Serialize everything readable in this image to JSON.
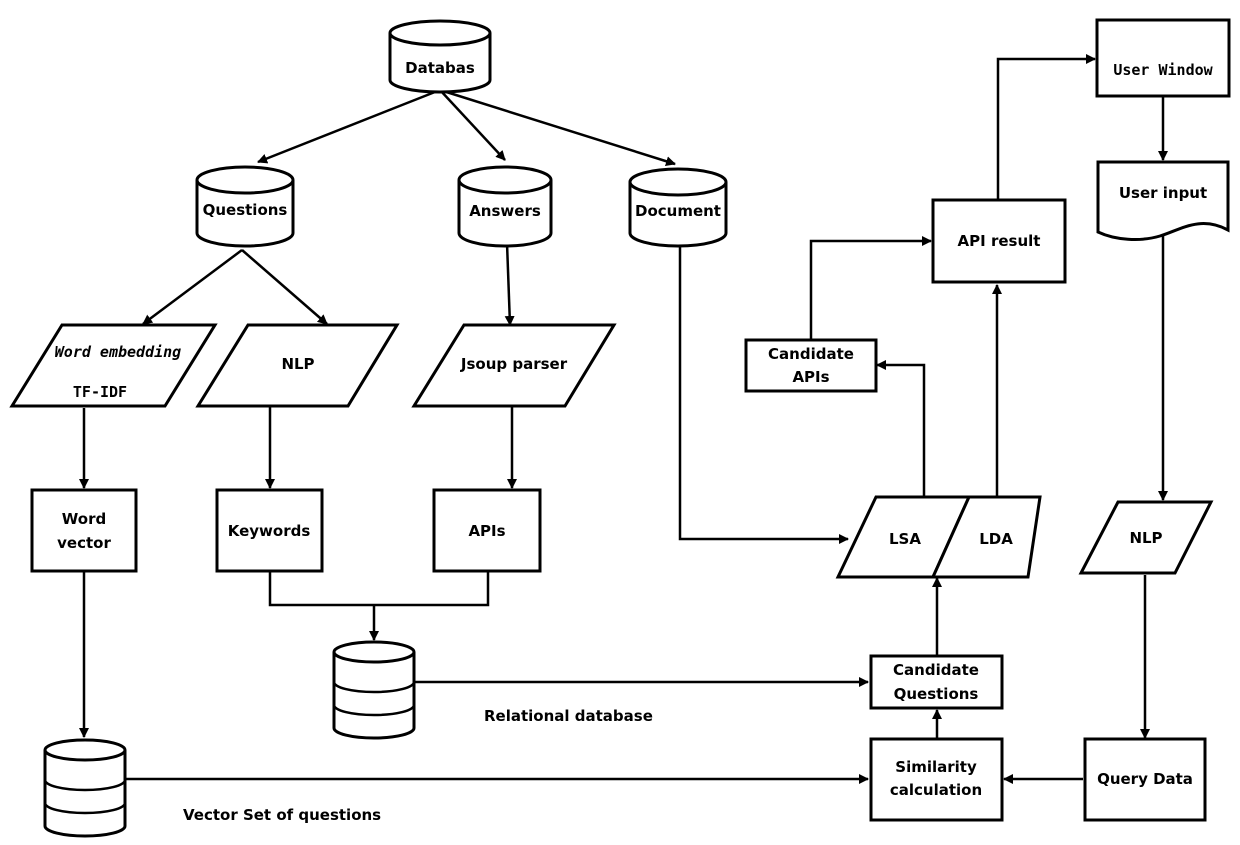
{
  "diagram": {
    "nodes": {
      "database": "Databas",
      "questions": "Questions",
      "answers": "Answers",
      "document": "Document",
      "word_embedding": "Word embedding",
      "tf_idf": "TF-IDF",
      "nlp_left": "NLP",
      "jsoup_parser": "Jsoup parser",
      "word_vector_line1": "Word",
      "word_vector_line2": "vector",
      "keywords": "Keywords",
      "apis": "APIs",
      "relational_db_caption": "Relational database",
      "vector_set_caption": "Vector Set of questions",
      "candidate_apis_line1": "Candidate",
      "candidate_apis_line2": "APIs",
      "api_result": "API result",
      "user_window": "User Window",
      "user_input": "User input",
      "lsa": "LSA",
      "lda": "LDA",
      "nlp_right": "NLP",
      "candidate_questions_line1": "Candidate",
      "candidate_questions_line2": "Questions",
      "similarity_line1": "Similarity",
      "similarity_line2": "calculation",
      "query_data": "Query Data"
    },
    "edges": [
      {
        "from": "Databas",
        "to": "Questions"
      },
      {
        "from": "Databas",
        "to": "Answers"
      },
      {
        "from": "Databas",
        "to": "Document"
      },
      {
        "from": "Questions",
        "to": "Word embedding / TF-IDF"
      },
      {
        "from": "Questions",
        "to": "NLP"
      },
      {
        "from": "Answers",
        "to": "Jsoup parser"
      },
      {
        "from": "Word embedding / TF-IDF",
        "to": "Word vector"
      },
      {
        "from": "NLP",
        "to": "Keywords"
      },
      {
        "from": "Jsoup parser",
        "to": "APIs"
      },
      {
        "from": "Keywords + APIs",
        "to": "Relational database"
      },
      {
        "from": "Word vector",
        "to": "Vector Set of questions"
      },
      {
        "from": "Document",
        "to": "LSA"
      },
      {
        "from": "Relational database",
        "to": "Candidate Questions"
      },
      {
        "from": "Vector Set of questions",
        "to": "Similarity calculation"
      },
      {
        "from": "Query Data",
        "to": "Similarity calculation"
      },
      {
        "from": "Similarity calculation",
        "to": "Candidate Questions"
      },
      {
        "from": "Candidate Questions",
        "to": "LSA/LDA"
      },
      {
        "from": "LSA",
        "to": "Candidate APIs"
      },
      {
        "from": "LDA",
        "to": "API result"
      },
      {
        "from": "Candidate APIs",
        "to": "API result"
      },
      {
        "from": "API result",
        "to": "User Window"
      },
      {
        "from": "User Window",
        "to": "User input"
      },
      {
        "from": "User input",
        "to": "NLP"
      },
      {
        "from": "NLP",
        "to": "Query Data"
      }
    ]
  }
}
